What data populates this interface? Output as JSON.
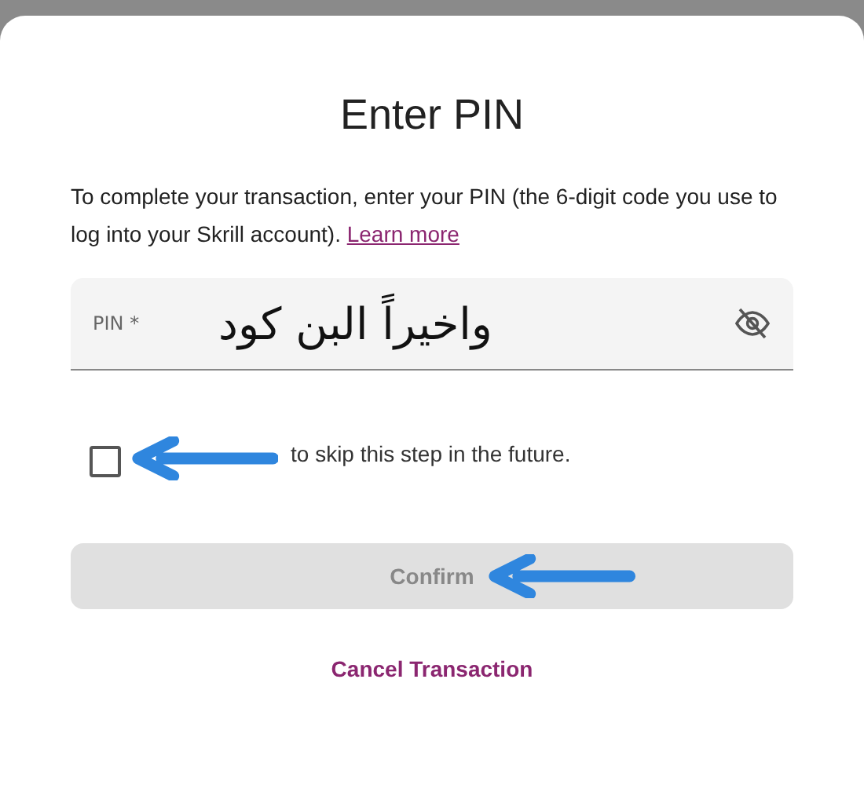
{
  "dialog": {
    "title": "Enter PIN",
    "description": "To complete your transaction, enter your PIN (the 6-digit code you use to log into your Skrill account).",
    "learn_more_link": "Learn more",
    "pin_field": {
      "label": "PIN *",
      "annotation": "واخيراً البن كود",
      "password_hidden": true
    },
    "remember_checkbox": {
      "label": "to skip this step in the future.",
      "checked": false
    },
    "confirm_button": {
      "label": "Confirm",
      "disabled": true
    },
    "cancel_link": "Cancel Transaction"
  }
}
